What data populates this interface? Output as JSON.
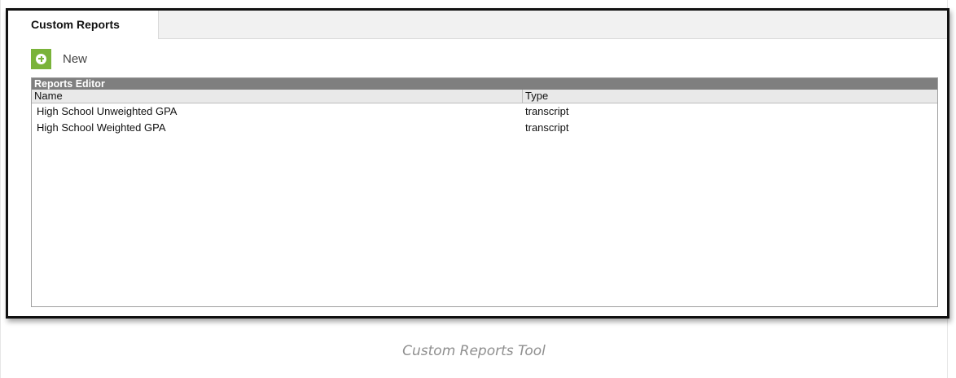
{
  "tabs": [
    {
      "label": "Custom Reports",
      "active": true
    }
  ],
  "toolbar": {
    "new_label": "New",
    "new_icon": "plus-circle-icon",
    "accent_color": "#7ab33a"
  },
  "editor": {
    "title": "Reports Editor",
    "columns": [
      "Name",
      "Type"
    ],
    "rows": [
      {
        "name": "High School Unweighted GPA",
        "type": "transcript"
      },
      {
        "name": "High School Weighted GPA",
        "type": "transcript"
      }
    ]
  },
  "caption": "Custom Reports Tool"
}
